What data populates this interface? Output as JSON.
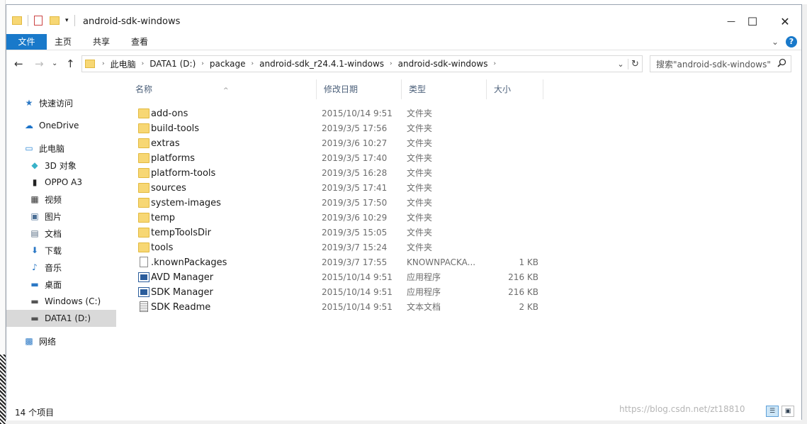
{
  "window": {
    "title": "android-sdk-windows"
  },
  "window_controls": {
    "minimize": "—",
    "maximize": "☐",
    "close": "✕"
  },
  "ribbon": {
    "tabs": [
      "文件",
      "主页",
      "共享",
      "查看"
    ],
    "expand_glyph": "⌄",
    "help_glyph": "?"
  },
  "nav": {
    "back": "←",
    "forward": "→",
    "recent": "⌄",
    "up": "↑"
  },
  "address": {
    "crumbs": [
      "此电脑",
      "DATA1 (D:)",
      "package",
      "android-sdk_r24.4.1-windows",
      "android-sdk-windows"
    ],
    "separator": "›",
    "dropdown": "⌄",
    "refresh": "↻"
  },
  "search": {
    "placeholder": "搜索\"android-sdk-windows\""
  },
  "sidebar": {
    "items": [
      {
        "label": "快速访问",
        "icon": "star-icon",
        "glyph": "★",
        "color": "#2b78c5"
      },
      {
        "label": "OneDrive",
        "icon": "cloud-icon",
        "glyph": "☁",
        "color": "#1c73c9"
      },
      {
        "label": "此电脑",
        "icon": "computer-icon",
        "glyph": "▭",
        "color": "#2e88d6"
      },
      {
        "label": "3D 对象",
        "icon": "cube-icon",
        "glyph": "◆",
        "color": "#38b2c9"
      },
      {
        "label": "OPPO A3",
        "icon": "phone-icon",
        "glyph": "▮",
        "color": "#222222"
      },
      {
        "label": "视频",
        "icon": "video-icon",
        "glyph": "▦",
        "color": "#333333"
      },
      {
        "label": "图片",
        "icon": "pictures-icon",
        "glyph": "▣",
        "color": "#4a6e95"
      },
      {
        "label": "文档",
        "icon": "documents-icon",
        "glyph": "▤",
        "color": "#5a6f86"
      },
      {
        "label": "下载",
        "icon": "download-icon",
        "glyph": "⬇",
        "color": "#2b78c5"
      },
      {
        "label": "音乐",
        "icon": "music-icon",
        "glyph": "♪",
        "color": "#2b78c5"
      },
      {
        "label": "桌面",
        "icon": "desktop-icon",
        "glyph": "▬",
        "color": "#2b78c5"
      },
      {
        "label": "Windows (C:)",
        "icon": "drive-c-icon",
        "glyph": "▬",
        "color": "#555555"
      },
      {
        "label": "DATA1 (D:)",
        "icon": "drive-d-icon",
        "glyph": "▬",
        "color": "#555555",
        "selected": true
      },
      {
        "label": "网络",
        "icon": "network-icon",
        "glyph": "▩",
        "color": "#2b78c5"
      }
    ]
  },
  "columns": {
    "name": "名称",
    "date": "修改日期",
    "type": "类型",
    "size": "大小",
    "sort_glyph": "^"
  },
  "files": [
    {
      "name": "add-ons",
      "date": "2015/10/14 9:51",
      "type": "文件夹",
      "size": "",
      "icon": "folder"
    },
    {
      "name": "build-tools",
      "date": "2019/3/5 17:56",
      "type": "文件夹",
      "size": "",
      "icon": "folder"
    },
    {
      "name": "extras",
      "date": "2019/3/6 10:27",
      "type": "文件夹",
      "size": "",
      "icon": "folder"
    },
    {
      "name": "platforms",
      "date": "2019/3/5 17:40",
      "type": "文件夹",
      "size": "",
      "icon": "folder"
    },
    {
      "name": "platform-tools",
      "date": "2019/3/5 16:28",
      "type": "文件夹",
      "size": "",
      "icon": "folder"
    },
    {
      "name": "sources",
      "date": "2019/3/5 17:41",
      "type": "文件夹",
      "size": "",
      "icon": "folder"
    },
    {
      "name": "system-images",
      "date": "2019/3/5 17:50",
      "type": "文件夹",
      "size": "",
      "icon": "folder"
    },
    {
      "name": "temp",
      "date": "2019/3/6 10:29",
      "type": "文件夹",
      "size": "",
      "icon": "folder"
    },
    {
      "name": "tempToolsDir",
      "date": "2019/3/5 15:05",
      "type": "文件夹",
      "size": "",
      "icon": "folder"
    },
    {
      "name": "tools",
      "date": "2019/3/7 15:24",
      "type": "文件夹",
      "size": "",
      "icon": "folder"
    },
    {
      "name": ".knownPackages",
      "date": "2019/3/7 17:55",
      "type": "KNOWNPACKA...",
      "size": "1 KB",
      "icon": "doc"
    },
    {
      "name": "AVD Manager",
      "date": "2015/10/14 9:51",
      "type": "应用程序",
      "size": "216 KB",
      "icon": "exe"
    },
    {
      "name": "SDK Manager",
      "date": "2015/10/14 9:51",
      "type": "应用程序",
      "size": "216 KB",
      "icon": "exe"
    },
    {
      "name": "SDK Readme",
      "date": "2015/10/14 9:51",
      "type": "文本文档",
      "size": "2 KB",
      "icon": "txt"
    }
  ],
  "status": {
    "count": "14 个项目"
  },
  "watermark": "https://blog.csdn.net/zt18810"
}
